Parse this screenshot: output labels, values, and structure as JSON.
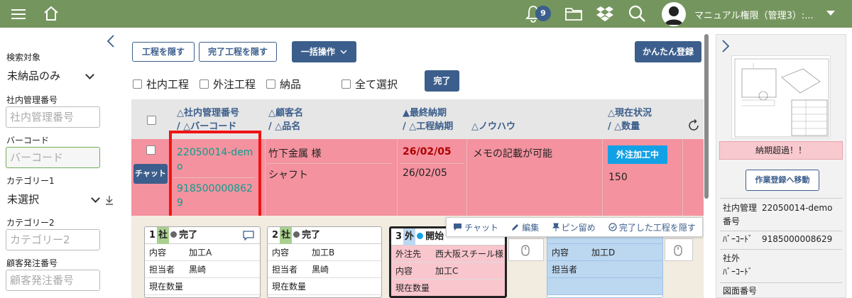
{
  "topbar": {
    "notification_count": "9",
    "user_name": "マニュアル権限（管理3）:..."
  },
  "filters": {
    "search_target_label": "検索対象",
    "search_target_value": "未納品のみ",
    "internal_no_label": "社内管理番号",
    "internal_no_placeholder": "社内管理番号",
    "barcode_label": "バーコード",
    "barcode_placeholder": "バーコード",
    "category1_label": "カテゴリー1",
    "category1_value": "未選択",
    "category2_label": "カテゴリー2",
    "category2_placeholder": "カテゴリー2",
    "customer_order_label": "顧客発注番号",
    "customer_order_placeholder": "顧客発注番号"
  },
  "toolbar": {
    "hide_process": "工程を隠す",
    "hide_done_process": "完了工程を隠す",
    "bulk_action": "一括操作",
    "easy_register": "かんたん登録",
    "cb_internal": "社内工程",
    "cb_external": "外注工程",
    "cb_delivery": "納品",
    "cb_select_all": "全て選択",
    "complete": "完了"
  },
  "table": {
    "headers": {
      "col1_a": "△社内管理番号",
      "col1_b": "/ △バーコード",
      "col2_a": "△顧客名",
      "col2_b": "/ △品名",
      "col3_a": "▲最終納期",
      "col3_b": "/ △工程納期",
      "col4": "△ノウハウ",
      "col5_a": "△現在状況",
      "col5_b": "/ △数量"
    },
    "row": {
      "chat": "チャット",
      "mgmt_no": "22050014-demo",
      "barcode": "9185000008629",
      "customer": "竹下金属 様",
      "product": "シャフト",
      "final_due": "26/02/05",
      "process_due": "26/02/05",
      "knowhow": "メモの記載が可能",
      "status": "外注加工中",
      "quantity": "150"
    }
  },
  "cards": [
    {
      "num": "1",
      "kind": "社",
      "state": "完了",
      "rows": [
        [
          "内容",
          "加工A"
        ],
        [
          "担当者",
          "黒崎"
        ],
        [
          "現在数量",
          ""
        ]
      ]
    },
    {
      "num": "2",
      "kind": "社",
      "state": "完了",
      "rows": [
        [
          "内容",
          "加工B"
        ],
        [
          "担当者",
          "黒崎"
        ],
        [
          "現在数量",
          ""
        ]
      ]
    },
    {
      "num": "3",
      "kind": "外",
      "state": "開始",
      "rows": [
        [
          "外注先",
          "西大阪スチール様"
        ],
        [
          "内容",
          "加工C"
        ],
        [
          "現在数量",
          ""
        ]
      ]
    },
    {
      "num": "",
      "kind": "",
      "state": "",
      "rows": [
        [
          "内容",
          "加工D"
        ],
        [
          "担当者",
          ""
        ]
      ]
    }
  ],
  "action_bar": {
    "chat": "チャット",
    "edit": "編集",
    "pin": "ピン留め",
    "hide_done": "完了した工程を隠す"
  },
  "detail": {
    "overdue": "納期超過！！",
    "goto_work": "作業登録へ移動",
    "mgmt_label_1": "社内管理",
    "mgmt_label_2": "番号",
    "mgmt_value": "22050014-demo",
    "barcode_label": "ﾊﾞｰｺｰﾄﾞ",
    "barcode_value": "9185000008629",
    "ext_label_1": "社外",
    "ext_label_2": "ﾊﾞｰｺｰﾄﾞ",
    "drawing_label": "図面番号"
  },
  "colors": {
    "topbar": "#75955e",
    "primary": "#3c5e8c",
    "row_alert": "#f4929f",
    "status_pill": "#13a1e6",
    "highlight_box": "#ef1414"
  }
}
